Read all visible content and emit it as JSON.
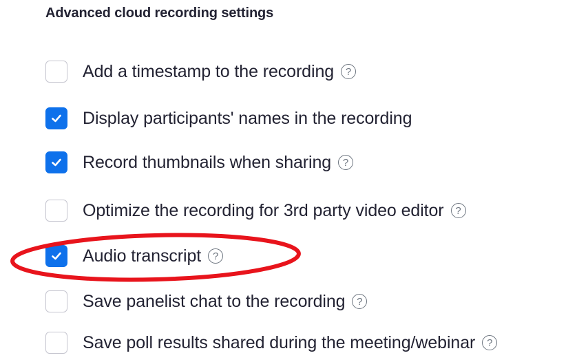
{
  "section": {
    "title": "Advanced cloud recording settings"
  },
  "options": [
    {
      "label": "Add a timestamp to the recording",
      "checked": false,
      "help": "?"
    },
    {
      "label": "Display participants' names in the recording",
      "checked": true
    },
    {
      "label": "Record thumbnails when sharing",
      "checked": true,
      "help": "?"
    },
    {
      "label": "Optimize the recording for 3rd party video editor",
      "checked": false,
      "help": "?"
    },
    {
      "label": "Audio transcript",
      "checked": true,
      "help": "?"
    },
    {
      "label": "Save panelist chat to the recording",
      "checked": false,
      "help": "?"
    },
    {
      "label": "Save poll results shared during the meeting/webinar",
      "checked": false,
      "help": "?"
    }
  ],
  "colors": {
    "checkbox_checked": "#0e71eb",
    "checkbox_border": "#c5c5cf",
    "text": "#232333",
    "help_icon": "#6e7680",
    "annotation": "#e8141c"
  }
}
